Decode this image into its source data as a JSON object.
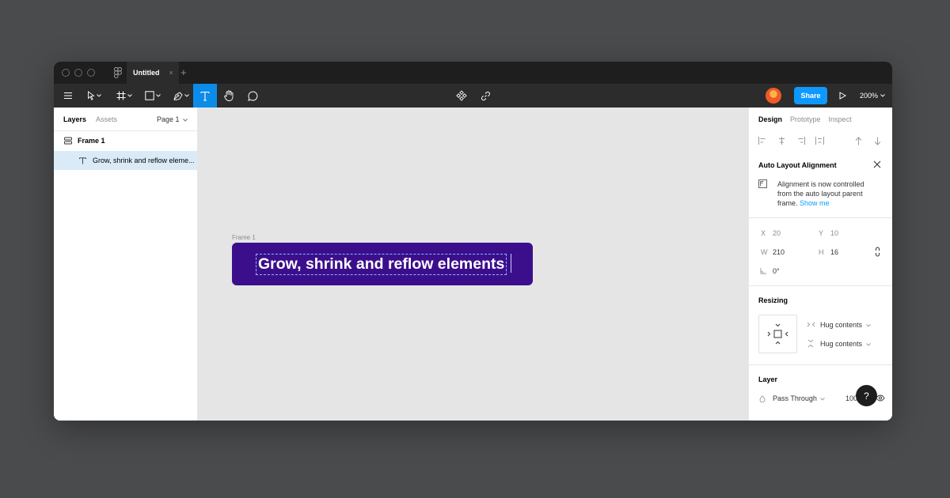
{
  "window": {
    "tab_title": "Untitled",
    "tab_close": "×",
    "new_tab": "+"
  },
  "toolbar": {
    "share_label": "Share",
    "zoom_label": "200%",
    "active_tool": "text"
  },
  "left_panel": {
    "tabs": [
      "Layers",
      "Assets"
    ],
    "page_selector": "Page 1",
    "layers": [
      {
        "name": "Frame 1",
        "icon": "auto-layout-icon",
        "selected": false
      },
      {
        "name": "Grow, shrink and reflow eleme...",
        "icon": "text-icon",
        "selected": true
      }
    ]
  },
  "canvas": {
    "frame_label": "Frame 1",
    "frame_text": "Grow, shrink and reflow elements",
    "frame_color": "#3b0f8c"
  },
  "right_panel": {
    "tabs": [
      "Design",
      "Prototype",
      "Inspect"
    ],
    "alignment_title": "Auto Layout Alignment",
    "alignment_message": "Alignment is now controlled from the auto layout parent frame.",
    "alignment_link": "Show me",
    "x_label": "X",
    "x_value": "20",
    "y_label": "Y",
    "y_value": "10",
    "w_label": "W",
    "w_value": "210",
    "h_label": "H",
    "h_value": "16",
    "rotation_value": "0°",
    "resizing_title": "Resizing",
    "resizing_h": "Hug contents",
    "resizing_v": "Hug contents",
    "layer_title": "Layer",
    "blend_mode": "Pass Through",
    "opacity": "100%"
  },
  "help_label": "?",
  "colors": {
    "accent": "#0d99ff",
    "active_tool": "#0c8ce9",
    "selection": "#daebf7",
    "toolbar": "#2c2c2c"
  }
}
